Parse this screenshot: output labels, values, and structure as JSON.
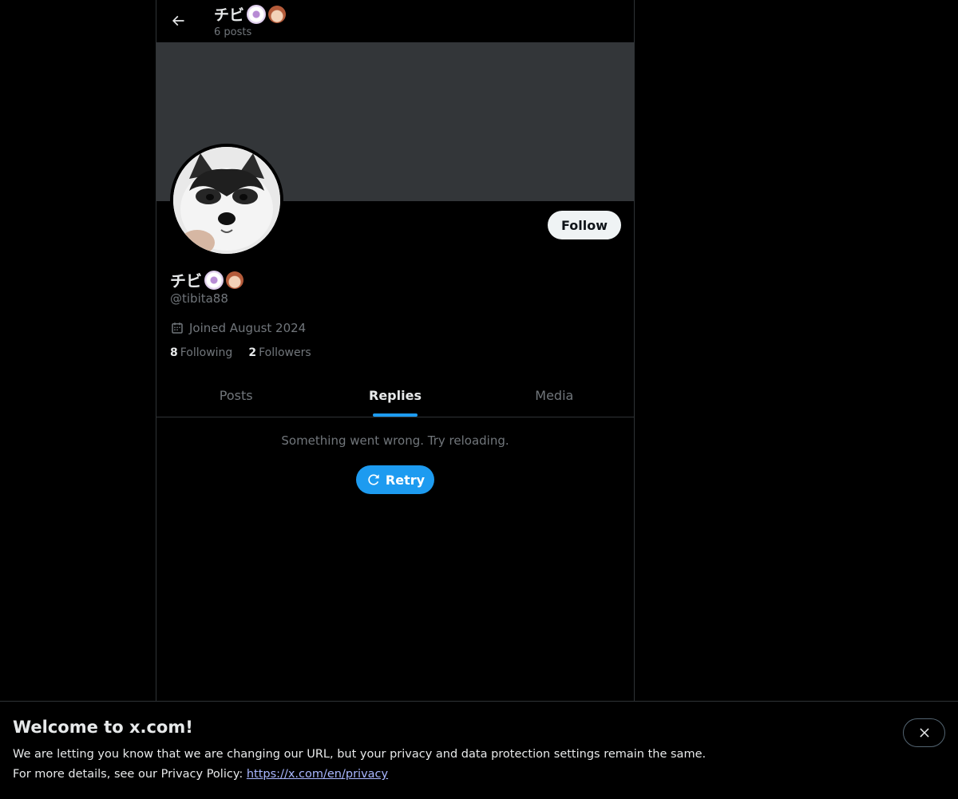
{
  "header": {
    "back_icon": "arrow-left-icon",
    "name": "チビ",
    "posts_count": "6 posts"
  },
  "profile": {
    "display_name": "チビ",
    "handle": "@tibita88",
    "follow_label": "Follow",
    "joined": "Joined August 2024",
    "following_count": "8",
    "following_label": "Following",
    "followers_count": "2",
    "followers_label": "Followers",
    "avatar": "husky-puppy-photo"
  },
  "tabs": [
    {
      "label": "Posts",
      "active": false
    },
    {
      "label": "Replies",
      "active": true
    },
    {
      "label": "Media",
      "active": false
    }
  ],
  "content": {
    "error_message": "Something went wrong. Try reloading.",
    "retry_label": "Retry"
  },
  "notice": {
    "title": "Welcome to x.com!",
    "line1": "We are letting you know that we are changing our URL, but your privacy and data protection settings remain the same.",
    "line2_prefix": "For more details, see our Privacy Policy: ",
    "link": "https://x.com/en/privacy"
  },
  "colors": {
    "accent": "#1d9bf0",
    "background": "#000000",
    "banner": "#333639",
    "muted_text": "#71767b"
  }
}
